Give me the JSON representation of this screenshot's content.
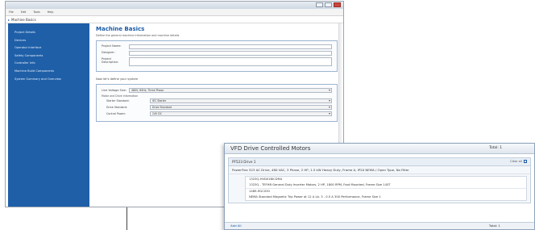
{
  "window": {
    "menu": [
      "File",
      "Edit",
      "Tools",
      "Help"
    ],
    "breadcrumb": "Machine Basics"
  },
  "sidebar": {
    "items": [
      "Project Details",
      "Devices",
      "Operator Interface",
      "Safety Components",
      "Controller Info",
      "Machine Build Components",
      "System Summary and Overview"
    ]
  },
  "main": {
    "title": "Machine Basics",
    "description": "Define the general machine information and machine details",
    "fields": {
      "project_name": "Project Name:",
      "designer": "Designer:",
      "project_description": "Project Description:"
    },
    "system_heading": "Now let's define your system",
    "line_voltage_label": "Line Voltage Size:",
    "line_voltage_value": "480V, 60Hz, Three Phase",
    "motor_caption": "Motor and Drive Information",
    "motor_selectors": [
      {
        "label": "Starter Standard:",
        "value": "IEC Starter"
      },
      {
        "label": "Drive Standard:",
        "value": "Drive Standard"
      },
      {
        "label": "Control Power:",
        "value": "24V DC"
      }
    ]
  },
  "motors": {
    "title": "VFD Drive Controlled Motors",
    "total_label": "Total: 1",
    "group_header": "PF523 Drive 1",
    "clear_all_label": "Clear all",
    "group_main": "PowerFlex 523 AC Drive, 480 VAC, 3 Phase, 2 HP, 1.5 kW Heavy Duty, Frame A, IP20 NEMA / Open Type, No Filter",
    "sub_items": [
      "1323Q-HVD01BICDM4",
      "1323Q - TEFHB General Duty Inverter Motors, 2 HP, 1800 RPM, Foot Mounted, Frame Size 145T",
      "1489-M1C030",
      "NEMA Standard Magnetic Trip Power at 12 A Lb. 3 - 0.5 A 300 Performance, Frame Size 1"
    ],
    "add_label": "Add All",
    "footer_total": "Total: 1"
  }
}
